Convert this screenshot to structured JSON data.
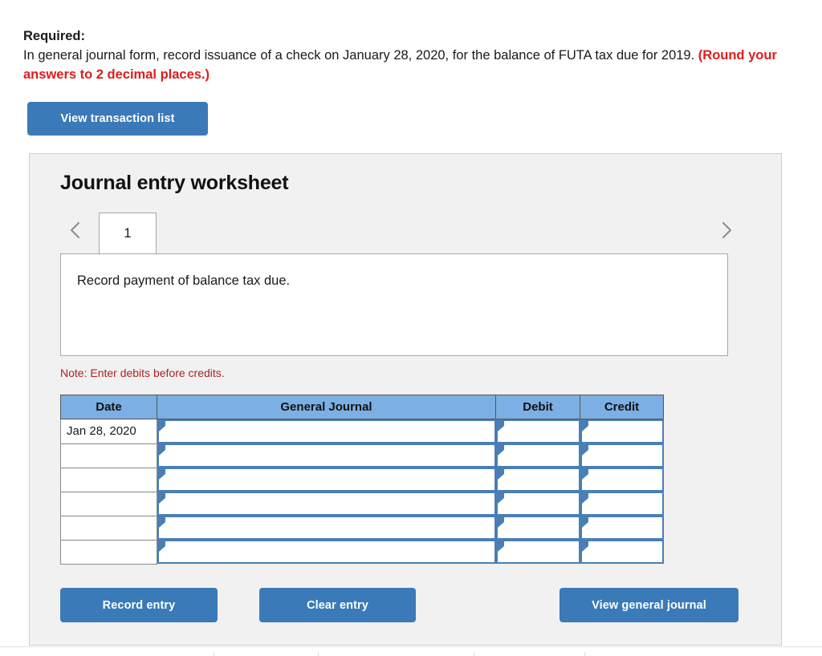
{
  "prompt": {
    "label": "Required:",
    "body_part1": "In general journal form, record issuance of a check on January 28, 2020, for the balance of FUTA tax due for 2019. ",
    "emphasis": "(Round your answers to 2 decimal places.)"
  },
  "toolbar": {
    "view_transaction_list": "View transaction list"
  },
  "worksheet": {
    "title": "Journal entry worksheet",
    "prev_arrow": "‹",
    "next_arrow": "›",
    "tabs": [
      {
        "label": "1",
        "active": true
      }
    ],
    "description": "Record payment of balance tax due.",
    "note": "Note: Enter debits before credits."
  },
  "table": {
    "headers": [
      "Date",
      "General Journal",
      "Debit",
      "Credit"
    ],
    "rows": [
      {
        "date": "Jan 28, 2020",
        "general_journal": "",
        "debit": "",
        "credit": ""
      },
      {
        "date": "",
        "general_journal": "",
        "debit": "",
        "credit": ""
      },
      {
        "date": "",
        "general_journal": "",
        "debit": "",
        "credit": ""
      },
      {
        "date": "",
        "general_journal": "",
        "debit": "",
        "credit": ""
      },
      {
        "date": "",
        "general_journal": "",
        "debit": "",
        "credit": ""
      },
      {
        "date": "",
        "general_journal": "",
        "debit": "",
        "credit": ""
      }
    ]
  },
  "actions": {
    "record_entry": "Record entry",
    "clear_entry": "Clear entry",
    "view_general_journal": "View general journal"
  },
  "colors": {
    "button_blue": "#3b7ab8",
    "header_blue": "#7cafe3",
    "field_border_blue": "#4a7fb5",
    "note_red": "#b02121",
    "emphasis_red": "#e01b1b",
    "panel_bg": "#f1f1f1"
  }
}
